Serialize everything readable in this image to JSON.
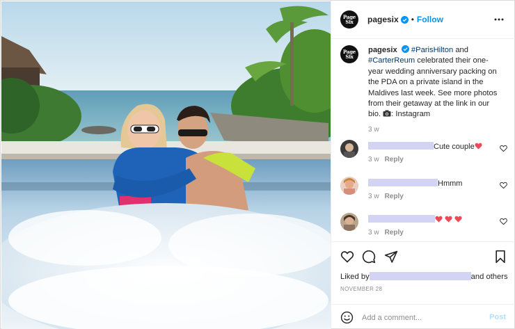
{
  "account": {
    "username": "pagesix",
    "avatar_text": "Page Six",
    "follow_label": "Follow",
    "separator": "•"
  },
  "caption": {
    "username": "pagesix",
    "hashtag_1": "#ParisHilton",
    "text_1": " and ",
    "hashtag_2": "#CarterReum",
    "text_2": " celebrated their one-year wedding anniversary packing on the PDA on a private island in the Maldives last week. See more photos from their getaway at the link in our bio. ",
    "text_3": ": Instagram",
    "time": "3 w"
  },
  "comments": [
    {
      "text": "Cute couple",
      "time": "3 w",
      "reply_label": "Reply"
    },
    {
      "text": "Hmmm",
      "time": "3 w",
      "reply_label": "Reply"
    },
    {
      "text": "",
      "time": "3 w",
      "reply_label": "Reply"
    }
  ],
  "likes": {
    "prefix": "Liked by",
    "suffix": "and others"
  },
  "post_date": "NOVEMBER 28",
  "comment_box": {
    "placeholder": "Add a comment...",
    "post_label": "Post"
  },
  "icons": {
    "header": [
      "verified-badge-icon",
      "more-options-icon"
    ],
    "actions": [
      "heart-icon",
      "comment-icon",
      "share-icon",
      "save-icon"
    ],
    "misc": [
      "camera-icon",
      "emoji-icon",
      "red-heart-icon"
    ]
  },
  "colors": {
    "follow_blue": "#0095f6",
    "hashtag": "#00376b",
    "verified": "#0095f6",
    "redaction": "#d3d4f3",
    "post_disabled": "#b2dffc",
    "heart_red": "#ed4956"
  }
}
